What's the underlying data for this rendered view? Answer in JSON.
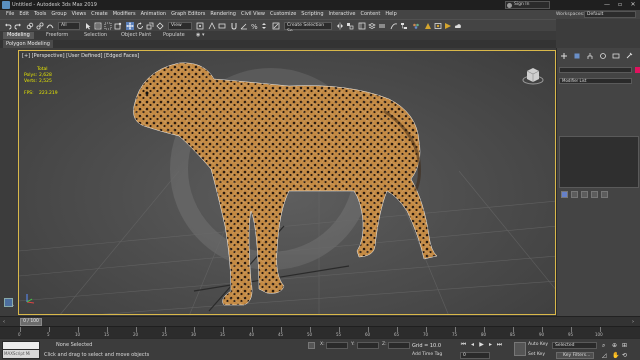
{
  "window": {
    "title": "Untitled - Autodesk 3ds Max 2019",
    "sign_in": "Sign In",
    "controls": [
      "—",
      "▫",
      "✕"
    ]
  },
  "menu": {
    "items": [
      "File",
      "Edit",
      "Tools",
      "Group",
      "Views",
      "Create",
      "Modifiers",
      "Animation",
      "Graph Editors",
      "Rendering",
      "Civil View",
      "Customize",
      "Scripting",
      "Interactive",
      "Content",
      "Help"
    ],
    "workspaces_label": "Workspaces:",
    "workspaces_value": "Default"
  },
  "toolbar": {
    "filter_value": "All",
    "view_value": "View",
    "selection_set": "Create Selection Se"
  },
  "ribbon": {
    "tabs": [
      "Modeling",
      "Freeform",
      "Selection",
      "Object Paint",
      "Populate"
    ],
    "sub_label": "Polygon Modeling"
  },
  "viewport": {
    "label": "[+] [Perspective] [User Defined] [Edged Faces]",
    "stats": {
      "total_label": "Total",
      "polys_label": "Polys:",
      "polys_value": "2,628",
      "verts_label": "Verts:",
      "verts_value": "2,525",
      "fps_label": "FPS:",
      "fps_value": "223.219"
    }
  },
  "command_panel": {
    "modifier_list": "Modifier List",
    "swatch_color": "#e0125e"
  },
  "timeline": {
    "slider_label": "0 / 100",
    "ticks": [
      "0",
      "5",
      "10",
      "15",
      "20",
      "25",
      "30",
      "35",
      "40",
      "45",
      "50",
      "55",
      "60",
      "65",
      "70",
      "75",
      "80",
      "85",
      "90",
      "95",
      "100"
    ]
  },
  "status": {
    "maxscript_label": "MAXScript Mi",
    "none_selected": "None Selected",
    "hint": "Click and drag to select and move objects",
    "x_label": "X:",
    "y_label": "Y:",
    "z_label": "Z:",
    "grid": "Grid = 10.0",
    "add_time_tag": "Add Time Tag",
    "auto_key": "Auto Key",
    "set_key": "Set Key",
    "selected": "Selected",
    "key_filters": "Key Filters...",
    "frame": "0"
  },
  "colors": {
    "viewport_border": "#d9b84a",
    "stats_text": "#e8e800",
    "accent_blue": "#5a8fbf"
  }
}
